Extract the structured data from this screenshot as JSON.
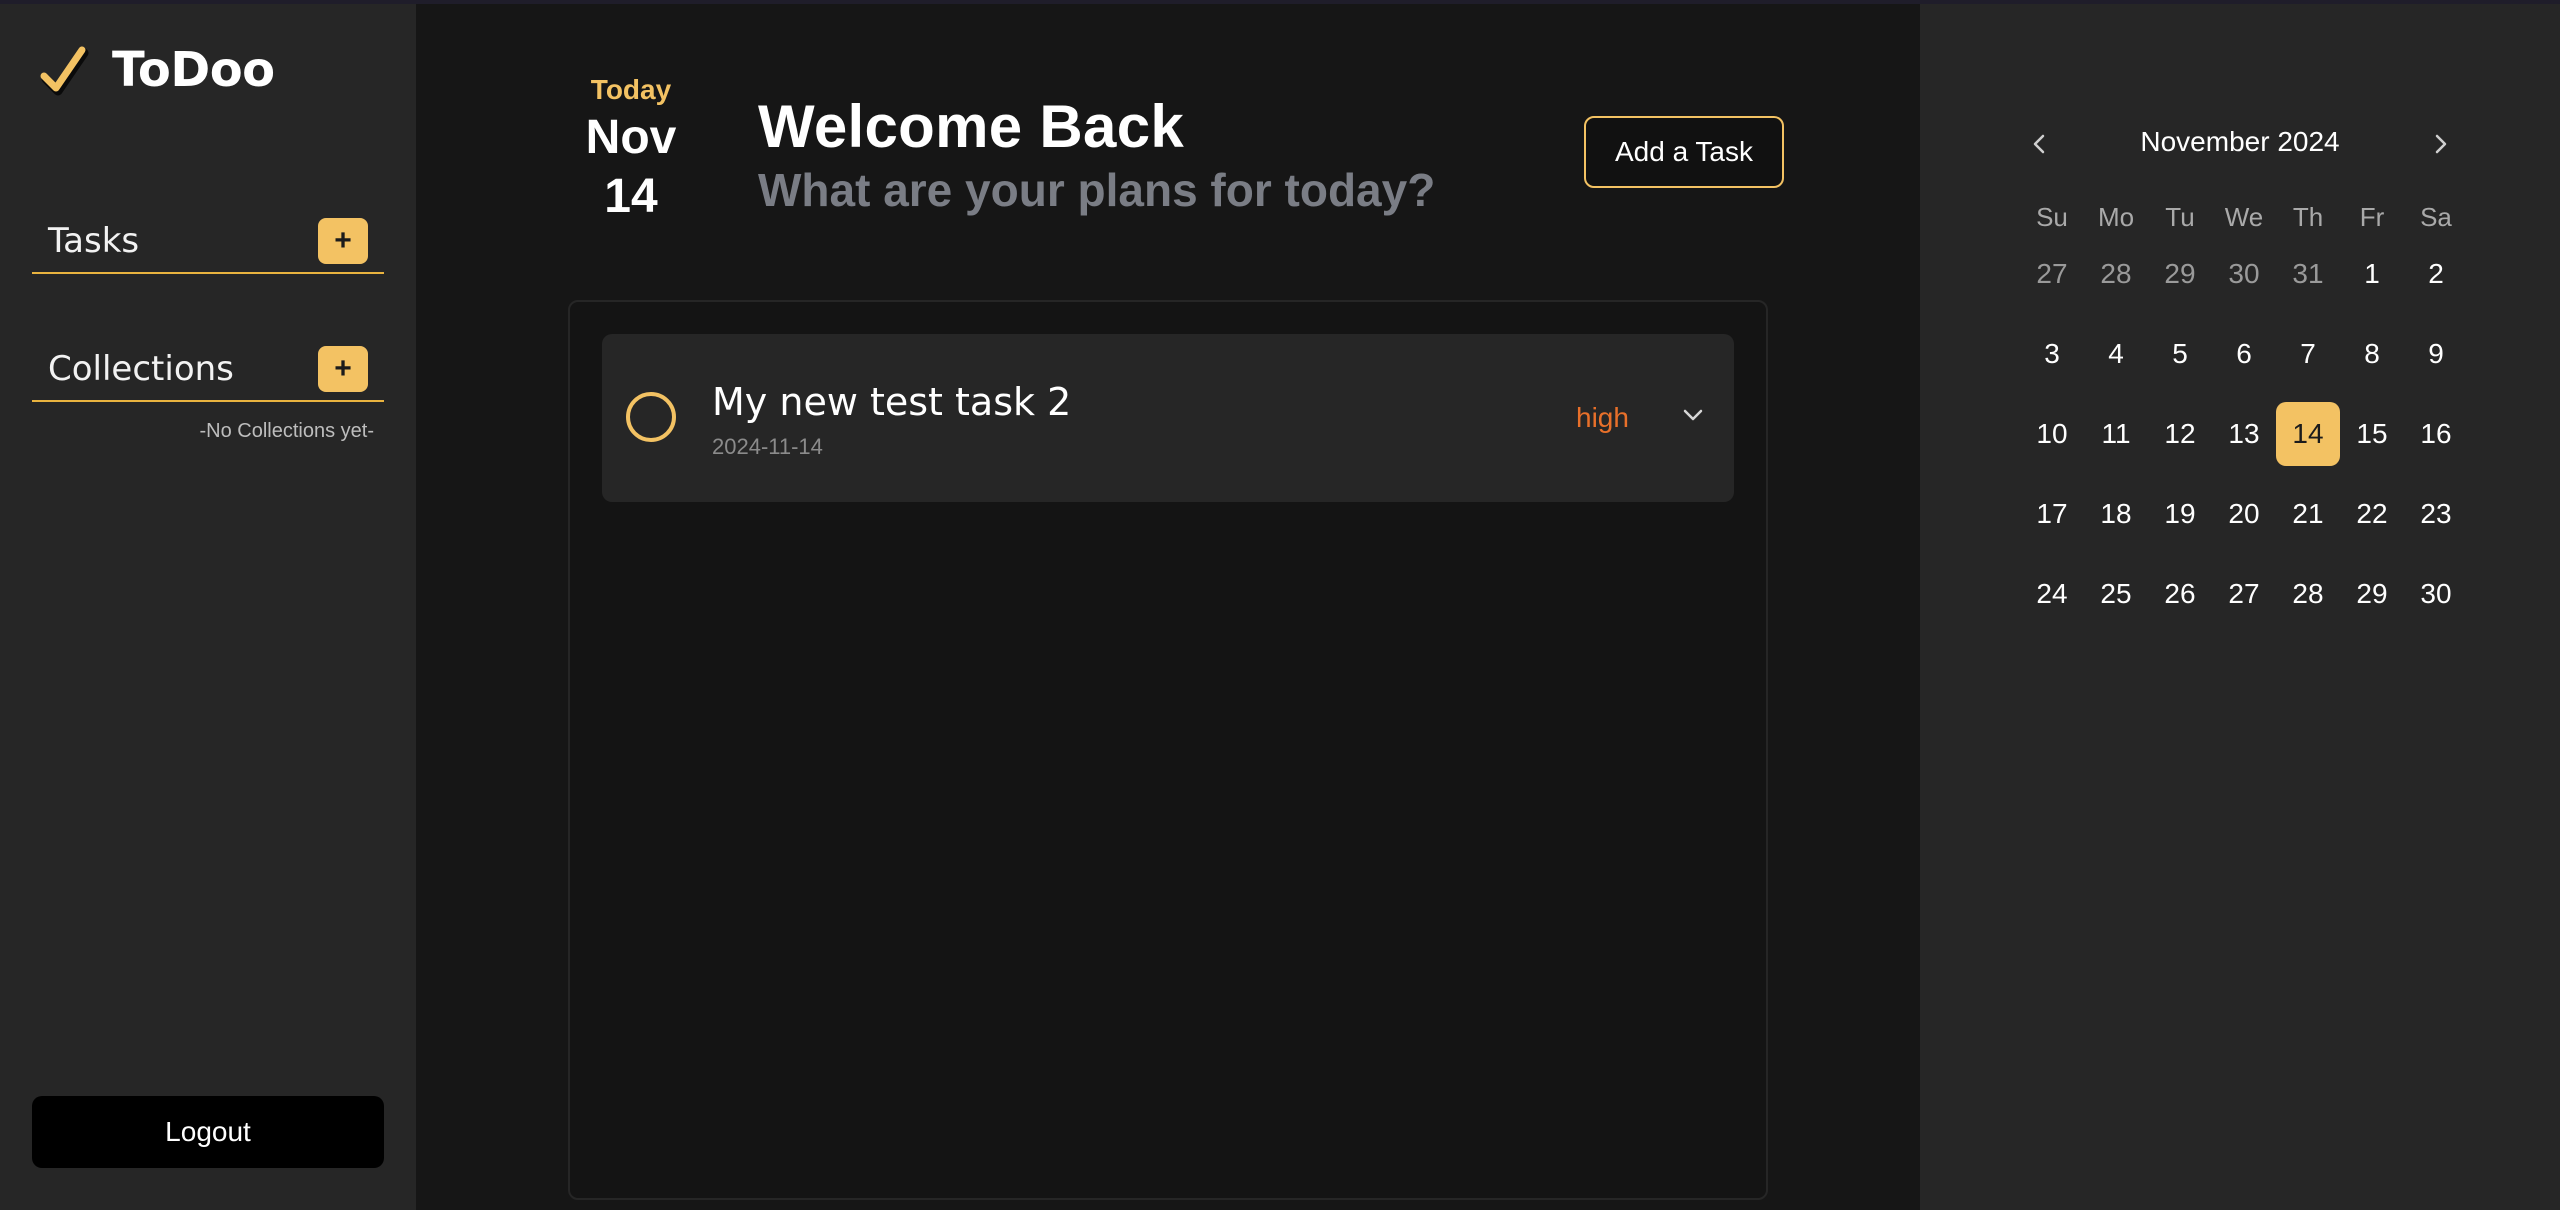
{
  "app": {
    "name": "ToDoo",
    "brand_icon": "checkmark-icon",
    "accent_color": "#f3c263",
    "priority_high_color": "#e8702a"
  },
  "sidebar": {
    "tasks_label": "Tasks",
    "collections_label": "Collections",
    "add_icon": "+",
    "no_collections": "-No Collections yet-",
    "logout_label": "Logout"
  },
  "header": {
    "today_label": "Today",
    "month": "Nov",
    "day": "14",
    "welcome_title": "Welcome Back",
    "welcome_subtitle": "What are your plans for today?",
    "add_task_label": "Add a Task"
  },
  "tasks": [
    {
      "title": "My new test task 2",
      "date": "2024-11-14",
      "priority": "high",
      "completed": false
    }
  ],
  "calendar": {
    "title": "November 2024",
    "prev_icon": "chevron-left-icon",
    "next_icon": "chevron-right-icon",
    "weekdays": [
      "Su",
      "Mo",
      "Tu",
      "We",
      "Th",
      "Fr",
      "Sa"
    ],
    "selected_day": "14",
    "weeks": [
      [
        {
          "d": "27",
          "muted": true
        },
        {
          "d": "28",
          "muted": true
        },
        {
          "d": "29",
          "muted": true
        },
        {
          "d": "30",
          "muted": true
        },
        {
          "d": "31",
          "muted": true
        },
        {
          "d": "1"
        },
        {
          "d": "2"
        }
      ],
      [
        {
          "d": "3"
        },
        {
          "d": "4"
        },
        {
          "d": "5"
        },
        {
          "d": "6"
        },
        {
          "d": "7"
        },
        {
          "d": "8"
        },
        {
          "d": "9"
        }
      ],
      [
        {
          "d": "10"
        },
        {
          "d": "11"
        },
        {
          "d": "12"
        },
        {
          "d": "13"
        },
        {
          "d": "14",
          "selected": true
        },
        {
          "d": "15"
        },
        {
          "d": "16"
        }
      ],
      [
        {
          "d": "17"
        },
        {
          "d": "18"
        },
        {
          "d": "19"
        },
        {
          "d": "20"
        },
        {
          "d": "21"
        },
        {
          "d": "22"
        },
        {
          "d": "23"
        }
      ],
      [
        {
          "d": "24"
        },
        {
          "d": "25"
        },
        {
          "d": "26"
        },
        {
          "d": "27"
        },
        {
          "d": "28"
        },
        {
          "d": "29"
        },
        {
          "d": "30"
        }
      ]
    ]
  }
}
